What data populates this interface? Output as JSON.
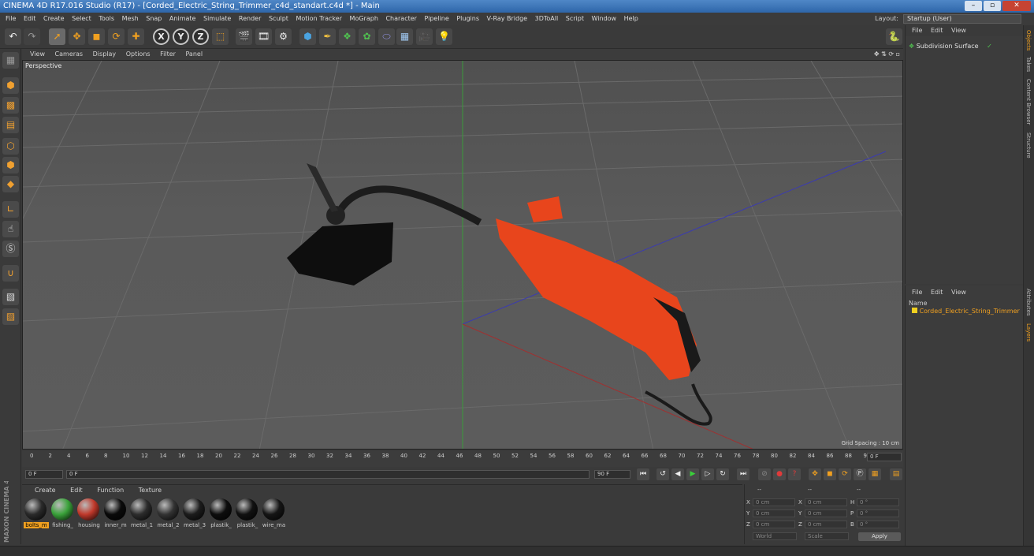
{
  "window": {
    "title": "CINEMA 4D R17.016 Studio (R17) - [Corded_Electric_String_Trimmer_c4d_standart.c4d *] - Main",
    "buttons": [
      "–",
      "▫",
      "✕"
    ]
  },
  "menubar": {
    "items": [
      "File",
      "Edit",
      "Create",
      "Select",
      "Tools",
      "Mesh",
      "Snap",
      "Animate",
      "Simulate",
      "Render",
      "Sculpt",
      "Motion Tracker",
      "MoGraph",
      "Character",
      "Pipeline",
      "Plugins",
      "V-Ray Bridge",
      "3DToAll",
      "Script",
      "Window",
      "Help"
    ],
    "layout_label": "Layout:",
    "layout_value": "Startup (User)"
  },
  "toolbar": {
    "axis_x": "X",
    "axis_y": "Y",
    "axis_z": "Z"
  },
  "viewport": {
    "menu": [
      "View",
      "Cameras",
      "Display",
      "Options",
      "Filter",
      "Panel"
    ],
    "camera_label": "Perspective",
    "grid_spacing": "Grid Spacing : 10 cm"
  },
  "timeline": {
    "ticks": [
      "0",
      "2",
      "4",
      "6",
      "8",
      "10",
      "12",
      "14",
      "16",
      "18",
      "20",
      "22",
      "24",
      "26",
      "28",
      "30",
      "32",
      "34",
      "36",
      "38",
      "40",
      "42",
      "44",
      "46",
      "48",
      "50",
      "52",
      "54",
      "56",
      "58",
      "60",
      "62",
      "64",
      "66",
      "68",
      "70",
      "72",
      "74",
      "76",
      "78",
      "80",
      "82",
      "84",
      "86",
      "88",
      "90"
    ],
    "current_frame": "0 F",
    "start_frame": "0 F",
    "range_start": "0 F",
    "range_end": "90 F",
    "end_frame": "90 F"
  },
  "materials": {
    "menu": [
      "Create",
      "Edit",
      "Function",
      "Texture"
    ],
    "items": [
      {
        "name": "bolts_m",
        "color": "#2a2a2a"
      },
      {
        "name": "fishing_",
        "color": "#3aa23a"
      },
      {
        "name": "housing",
        "color": "#c0392b"
      },
      {
        "name": "inner_m",
        "color": "#0a0a0a"
      },
      {
        "name": "metal_1",
        "color": "#2c2c2c"
      },
      {
        "name": "metal_2",
        "color": "#333333"
      },
      {
        "name": "metal_3",
        "color": "#1c1c1c"
      },
      {
        "name": "plastik_",
        "color": "#0d0d0d"
      },
      {
        "name": "plastik_",
        "color": "#111111"
      },
      {
        "name": "wire_ma",
        "color": "#151515"
      }
    ]
  },
  "coordinates": {
    "header": [
      "--",
      "--",
      "--"
    ],
    "rows": [
      {
        "a": "X",
        "av": "0 cm",
        "b": "X",
        "bv": "0 cm",
        "c": "H",
        "cv": "0 °"
      },
      {
        "a": "Y",
        "av": "0 cm",
        "b": "Y",
        "bv": "0 cm",
        "c": "P",
        "cv": "0 °"
      },
      {
        "a": "Z",
        "av": "0 cm",
        "b": "Z",
        "bv": "0 cm",
        "c": "B",
        "cv": "0 °"
      }
    ],
    "mode1": "World",
    "mode2": "Scale",
    "apply": "Apply"
  },
  "objects_panel": {
    "menu": [
      "File",
      "Edit",
      "View"
    ],
    "items": [
      "Subdivision Surface"
    ]
  },
  "layers_panel": {
    "menu": [
      "File",
      "Edit",
      "View"
    ],
    "header": "Name",
    "items": [
      "Corded_Electric_String_Trimmer"
    ]
  },
  "side_tabs": [
    "Objects",
    "Takes",
    "Content Browser",
    "Structure",
    "Attributes",
    "Layers"
  ],
  "branding": "MAXON CINEMA 4D",
  "colors": {
    "accent": "#f0a020",
    "trimmer_body": "#e8451c",
    "bg": "#3a3a3a"
  }
}
